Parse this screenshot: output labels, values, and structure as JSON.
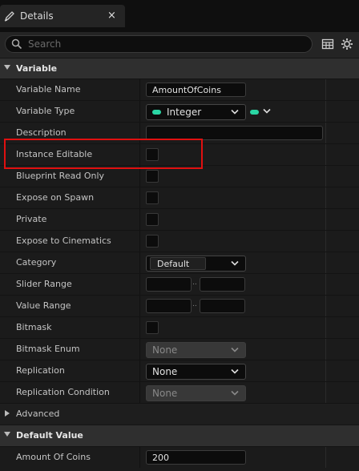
{
  "tab": {
    "title": "Details",
    "close": "×"
  },
  "search": {
    "placeholder": "Search"
  },
  "sections": {
    "variable": "Variable",
    "advanced": "Advanced",
    "default_value": "Default Value"
  },
  "rows": {
    "variable_name": {
      "label": "Variable Name",
      "value": "AmountOfCoins"
    },
    "variable_type": {
      "label": "Variable Type",
      "value": "Integer"
    },
    "description": {
      "label": "Description",
      "value": ""
    },
    "instance_editable": {
      "label": "Instance Editable"
    },
    "blueprint_read_only": {
      "label": "Blueprint Read Only"
    },
    "expose_on_spawn": {
      "label": "Expose on Spawn"
    },
    "private": {
      "label": "Private"
    },
    "expose_to_cinematics": {
      "label": "Expose to Cinematics"
    },
    "category": {
      "label": "Category",
      "value": "Default"
    },
    "slider_range": {
      "label": "Slider Range",
      "separator": ".."
    },
    "value_range": {
      "label": "Value Range",
      "separator": ".."
    },
    "bitmask": {
      "label": "Bitmask"
    },
    "bitmask_enum": {
      "label": "Bitmask Enum",
      "value": "None"
    },
    "replication": {
      "label": "Replication",
      "value": "None"
    },
    "replication_condition": {
      "label": "Replication Condition",
      "value": "None"
    },
    "amount_of_coins": {
      "label": "Amount Of Coins",
      "value": "200"
    }
  },
  "colors": {
    "pin_integer": "#2ad6a4",
    "highlight": "#e01010"
  },
  "icons": [
    "pencil-icon",
    "search-icon",
    "table-view-icon",
    "settings-gear-icon",
    "chevron-down-icon",
    "expand-arrow-icon"
  ]
}
